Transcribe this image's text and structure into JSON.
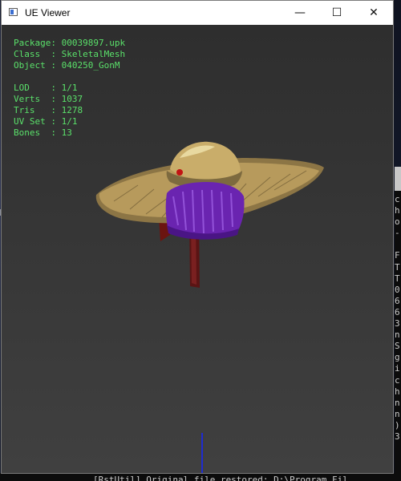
{
  "window": {
    "title": "UE Viewer",
    "minimize_glyph": "—",
    "maximize_glyph": "☐",
    "close_glyph": "✕"
  },
  "mesh_info": {
    "rows": [
      {
        "label": "Package:",
        "value": "00039897.upk"
      },
      {
        "label": "Class  :",
        "value": "SkeletalMesh"
      },
      {
        "label": "Object :",
        "value": "040250_GonM"
      }
    ],
    "stats": [
      {
        "label": "LOD    :",
        "value": "1/1"
      },
      {
        "label": "Verts  :",
        "value": "1037"
      },
      {
        "label": "Tris   :",
        "value": "1278"
      },
      {
        "label": "UV Set :",
        "value": "1/1"
      },
      {
        "label": "Bones  :",
        "value": "13"
      }
    ]
  },
  "background_console": {
    "left_edge_char": "M",
    "right_column_chars": [
      "c",
      "h",
      "o",
      "-",
      "",
      "F",
      "T",
      "T",
      "0",
      "6",
      "6",
      "3",
      "n",
      "S",
      "g",
      "i",
      "c",
      "h",
      "n",
      "n",
      ")",
      "3"
    ],
    "bottom_line": "[RstUtil] Original file restored: D:\\Program Fil"
  },
  "colors": {
    "info_text": "#5ae06a",
    "axis_line": "#1f2ccf",
    "hat_straw": "#b79a5c",
    "hair_purple": "#7a2bc9"
  }
}
